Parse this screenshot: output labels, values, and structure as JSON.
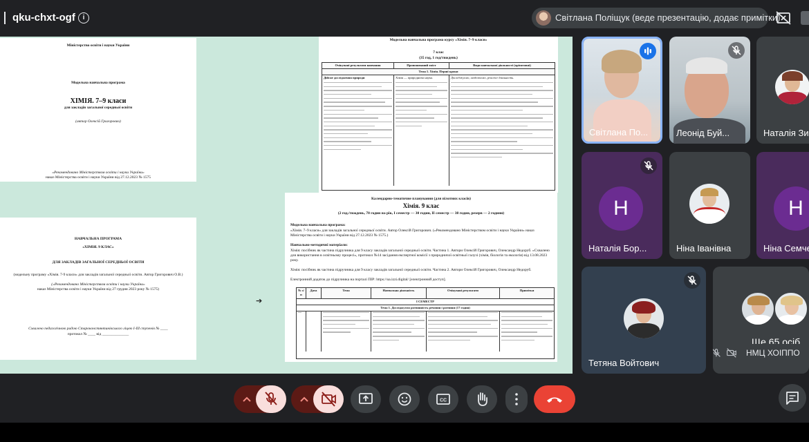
{
  "meeting": {
    "code": "qku-chxt-ogf"
  },
  "presenter_chip": {
    "text": "Світлана Поліщук (веде презентацію, додає примітки)"
  },
  "shared_slide": {
    "page1": {
      "ministry": "Міністерство освіти і науки України",
      "kind": "Модельна навчальна програма",
      "title": "ХІМІЯ. 7–9 класи",
      "subtitle": "для закладів загальної середньої освіти",
      "author": "(автор Олексій Григорович)",
      "recommend": "«Рекомендовано Міністерством освіти і науки України»",
      "order": "наказ Міністерства освіти і науки України від 27.12.2023 № 1575"
    },
    "page2": {
      "title": "НАВЧАЛЬНА ПРОГРАМА",
      "class": "«ХІМІЯ. 9 КЛАС»",
      "for": "ДЛЯ ЗАКЛАДІВ ЗАГАЛЬНОЇ СЕРЕДНЬОЇ ОСВІТИ",
      "based": "(модельну програму «Хімія. 7-9 класи» для закладів загальної середньої освіти. Автор Григорович О.В.)",
      "recommend": "(«Рекомендовано Міністерством освіти і науки України»",
      "order": "наказ Міністерства освіти і науки України від 27 грудня 2023 року № 1575)",
      "approve": "Схвалено педагогічною радою Староконстянтинівського ліцею І-ІІІ ступенів № ____",
      "protocol": "протокол № ____ від ______________"
    },
    "page3": {
      "title": "Модельна навчальна програма курсу «Хімія. 7–9 класи»",
      "grade": "7 клас",
      "hours": "(35 год, 1 год/тиждень)",
      "columns": [
        "Очікувані результати навчання",
        "Пропонований зміст",
        "Види навчальної діяльності (орієнтовні)"
      ],
      "topic": "Тема 1. Хімія. Перші кроки",
      "col1_head": "Дійсне дослідження природи",
      "col2_head": "Хімія — природнича наука.",
      "col3_head": "Досліджуємо, моделюємо, practice діяльність."
    },
    "page4": {
      "title": "Календарно-тематичне планування (для пілотних класів)",
      "subject": "Хімія. 9 клас",
      "hours": "(2 год./тиждень, 70 годин на рік, І семестр — 30 годин, ІІ семестр — 38 годин, резерв — 2 години)",
      "model_label": "Модельна навчальна програма:",
      "model_text": "«Хімія. 7–9 класи» для закладів загальної середньої освіти. Автор Олексій Григорович. («Рекомендовано Міністерством освіти і науки України» наказ Міністерства освіти і науки України від 27.12.2023 № 1575.)",
      "materials_label": "Навчально-методичні матеріали:",
      "materials_text": "Хімія: посібник як частина підручника для 9 класу закладів загальної середньої освіти. Частина 1. Автори Олексій Григорович, Олександр Недоруб. «Схвалено для використання в освітньому процесі», протокол №14 засідання експертної комісії з природничої освітньої галузі (хімія, біологія та екологія) від 13.08.2023 року.",
      "materials_text2": "Хімія: посібник як частина підручника для 9 класу закладів загальної середньої освіти. Частина 2. Автори Олексій Григорович, Олександр Недоруб.",
      "electronic": "Електронний додаток до підручника на порталі ПІР: https://ua.izzi.digital/ [електронний доступ].",
      "columns": [
        "№ з/п",
        "Дата",
        "Тема",
        "Навчальна діяльність",
        "Очікувані результати",
        "Примітки"
      ],
      "semester": "І СЕМЕСТР",
      "topic": "Тема 1. Досліджуємо розчинність речовин і розчини (17 годин)"
    }
  },
  "participants": [
    {
      "name": "Світлана По...",
      "active": true
    },
    {
      "name": "Леонід Буй..."
    },
    {
      "name": "Наталія Зи..."
    },
    {
      "name": "Наталія Бор...",
      "initial": "Н"
    },
    {
      "name": "Ніна Іванівна"
    },
    {
      "name": "Ніна Семче...",
      "initial": "Н"
    },
    {
      "name": "Тетяна Войтович"
    }
  ],
  "more_tile": {
    "count_label": "Ще 65 осіб",
    "pinned_name": "НМЦ ХОІППО"
  },
  "colors": {
    "accent": "#8ab4f8",
    "hangup": "#ea4335",
    "mic_off_bg": "#f9dedc",
    "background": "#202124"
  },
  "icons": [
    "info-icon",
    "cancel-presentation-icon",
    "mic-off-icon",
    "mic-active-icon",
    "camera-off-icon",
    "chevron-up-icon",
    "present-screen-icon",
    "emoji-icon",
    "captions-icon",
    "raise-hand-icon",
    "more-vert-icon",
    "call-end-icon",
    "chat-icon"
  ]
}
